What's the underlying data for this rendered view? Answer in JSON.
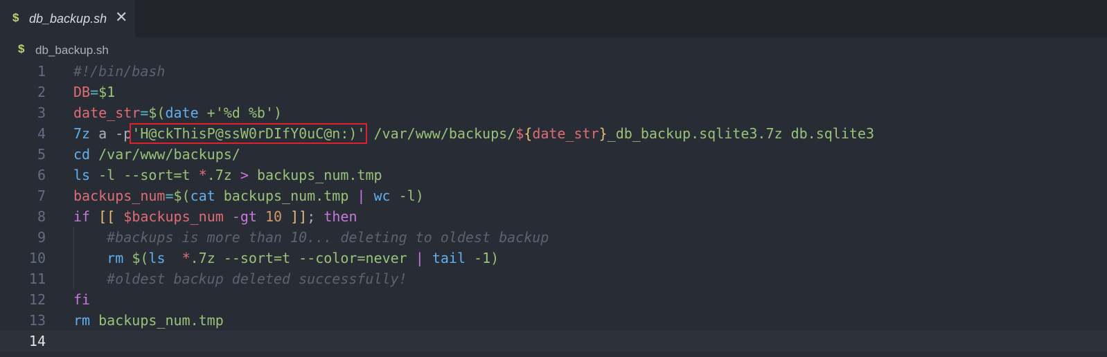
{
  "tab": {
    "icon": "$",
    "label": "db_backup.sh",
    "close": "✕"
  },
  "breadcrumb": {
    "icon": "$",
    "label": "db_backup.sh"
  },
  "lines": [
    {
      "num": "1",
      "tokens": [
        {
          "cls": "c",
          "text": "#!/bin/bash"
        }
      ]
    },
    {
      "num": "2",
      "tokens": [
        {
          "cls": "v",
          "text": "DB"
        },
        {
          "cls": "o",
          "text": "="
        },
        {
          "cls": "s",
          "text": "$1"
        }
      ]
    },
    {
      "num": "3",
      "tokens": [
        {
          "cls": "v",
          "text": "date_str"
        },
        {
          "cls": "o",
          "text": "="
        },
        {
          "cls": "s",
          "text": "$("
        },
        {
          "cls": "f",
          "text": "date"
        },
        {
          "cls": "s",
          "text": " +'%d %b')"
        }
      ]
    },
    {
      "num": "4",
      "tokens": [
        {
          "cls": "f",
          "text": "7z"
        },
        {
          "cls": "t",
          "text": " a -p"
        },
        {
          "cls": "s",
          "text": "'H@ckThisP@ssW0rDIfY0uC@n:)'",
          "hl": true
        },
        {
          "cls": "s",
          "text": " /var/www/backups/"
        },
        {
          "cls": "v",
          "text": "$"
        },
        {
          "cls": "y",
          "text": "{"
        },
        {
          "cls": "v",
          "text": "date_str"
        },
        {
          "cls": "y",
          "text": "}"
        },
        {
          "cls": "s",
          "text": "_db_backup.sqlite3.7z db.sqlite3"
        }
      ]
    },
    {
      "num": "5",
      "tokens": [
        {
          "cls": "f",
          "text": "cd"
        },
        {
          "cls": "s",
          "text": " /var/www/backups/"
        }
      ]
    },
    {
      "num": "6",
      "tokens": [
        {
          "cls": "f",
          "text": "ls"
        },
        {
          "cls": "s",
          "text": " -l --sort=t "
        },
        {
          "cls": "v",
          "text": "*"
        },
        {
          "cls": "s",
          "text": ".7z "
        },
        {
          "cls": "k",
          "text": ">"
        },
        {
          "cls": "s",
          "text": " backups_num.tmp"
        }
      ]
    },
    {
      "num": "7",
      "tokens": [
        {
          "cls": "v",
          "text": "backups_num"
        },
        {
          "cls": "o",
          "text": "="
        },
        {
          "cls": "s",
          "text": "$("
        },
        {
          "cls": "f",
          "text": "cat"
        },
        {
          "cls": "s",
          "text": " backups_num.tmp "
        },
        {
          "cls": "k",
          "text": "|"
        },
        {
          "cls": "s",
          "text": " "
        },
        {
          "cls": "f",
          "text": "wc"
        },
        {
          "cls": "s",
          "text": " -l)"
        }
      ]
    },
    {
      "num": "8",
      "tokens": [
        {
          "cls": "k",
          "text": "if"
        },
        {
          "cls": "t",
          "text": " "
        },
        {
          "cls": "y",
          "text": "[["
        },
        {
          "cls": "t",
          "text": " "
        },
        {
          "cls": "v",
          "text": "$backups_num"
        },
        {
          "cls": "t",
          "text": " "
        },
        {
          "cls": "k",
          "text": "-gt"
        },
        {
          "cls": "t",
          "text": " "
        },
        {
          "cls": "n",
          "text": "10"
        },
        {
          "cls": "t",
          "text": " "
        },
        {
          "cls": "y",
          "text": "]]"
        },
        {
          "cls": "t",
          "text": "; "
        },
        {
          "cls": "k",
          "text": "then"
        }
      ]
    },
    {
      "num": "9",
      "indent": true,
      "tokens": [
        {
          "cls": "c",
          "text": "    #backups is more than 10... deleting to oldest backup"
        }
      ]
    },
    {
      "num": "10",
      "indent": true,
      "tokens": [
        {
          "cls": "t",
          "text": "    "
        },
        {
          "cls": "f",
          "text": "rm"
        },
        {
          "cls": "t",
          "text": " "
        },
        {
          "cls": "s",
          "text": "$("
        },
        {
          "cls": "f",
          "text": "ls"
        },
        {
          "cls": "s",
          "text": "  "
        },
        {
          "cls": "v",
          "text": "*"
        },
        {
          "cls": "s",
          "text": ".7z --sort=t --color=never "
        },
        {
          "cls": "k",
          "text": "|"
        },
        {
          "cls": "s",
          "text": " "
        },
        {
          "cls": "f",
          "text": "tail"
        },
        {
          "cls": "s",
          "text": " -1)"
        }
      ]
    },
    {
      "num": "11",
      "indent": true,
      "tokens": [
        {
          "cls": "c",
          "text": "    #oldest backup deleted successfully!"
        }
      ]
    },
    {
      "num": "12",
      "tokens": [
        {
          "cls": "k",
          "text": "fi"
        }
      ]
    },
    {
      "num": "13",
      "tokens": [
        {
          "cls": "f",
          "text": "rm"
        },
        {
          "cls": "s",
          "text": " backups_num.tmp"
        }
      ]
    },
    {
      "num": "14",
      "active": true,
      "tokens": []
    }
  ]
}
